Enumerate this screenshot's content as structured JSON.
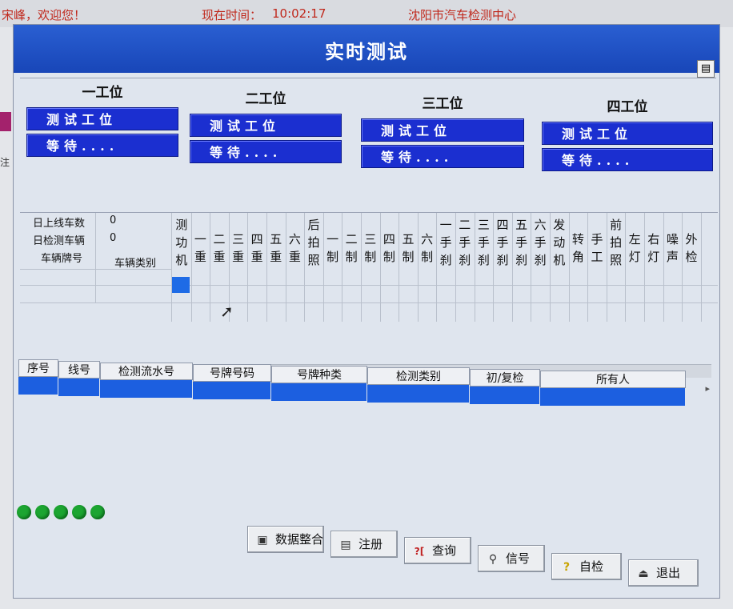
{
  "topbar": {
    "welcome": "宋峰，欢迎您！",
    "time_label": "现在时间：",
    "time_value": "10:02:17",
    "center": "沈阳市汽车检测中心"
  },
  "window": {
    "title": "实时测试",
    "corner_icon": "clipboard-icon"
  },
  "left_edge_char": "注",
  "stations": [
    {
      "title": "一工位",
      "status_line1": "测试工位",
      "status_line2": "等待...."
    },
    {
      "title": "二工位",
      "status_line1": "测试工位",
      "status_line2": "等待...."
    },
    {
      "title": "三工位",
      "status_line1": "测试工位",
      "status_line2": "等待...."
    },
    {
      "title": "四工位",
      "status_line1": "测试工位",
      "status_line2": "等待...."
    }
  ],
  "grid": {
    "online_label": "日上线车数",
    "online_value": "0",
    "tested_label": "日检测车辆",
    "tested_value": "0",
    "plate_header": "车辆牌号",
    "type_header": "车辆类别",
    "columns": [
      "测功机",
      "一重",
      "二重",
      "三重",
      "四重",
      "五重",
      "六重",
      "后拍照",
      "一制",
      "二制",
      "三制",
      "四制",
      "五制",
      "六制",
      "一手刹",
      "二手刹",
      "三手刹",
      "四手刹",
      "五手刹",
      "六手刹",
      "发动机",
      "转角",
      "手工",
      "前拍照",
      "左灯",
      "右灯",
      "噪声",
      "外检"
    ]
  },
  "records": {
    "headers": [
      "序号",
      "线号",
      "检测流水号",
      "号牌号码",
      "号牌种类",
      "检测类别",
      "初/复检",
      "所有人"
    ]
  },
  "status_lights": 5,
  "buttons": [
    {
      "label": "数据整合",
      "icon": "data-merge-icon"
    },
    {
      "label": "注册",
      "icon": "register-icon"
    },
    {
      "label": "查询",
      "icon": "query-icon"
    },
    {
      "label": "信号",
      "icon": "signal-icon"
    },
    {
      "label": "自检",
      "icon": "question-icon"
    },
    {
      "label": "退出",
      "icon": "exit-icon"
    }
  ],
  "colors": {
    "title_blue": "#1846b8",
    "station_blue": "#1b2fd0",
    "selection_blue": "#1c5fe0",
    "light_green": "#1ca531",
    "topbar_red": "#c0281c"
  }
}
